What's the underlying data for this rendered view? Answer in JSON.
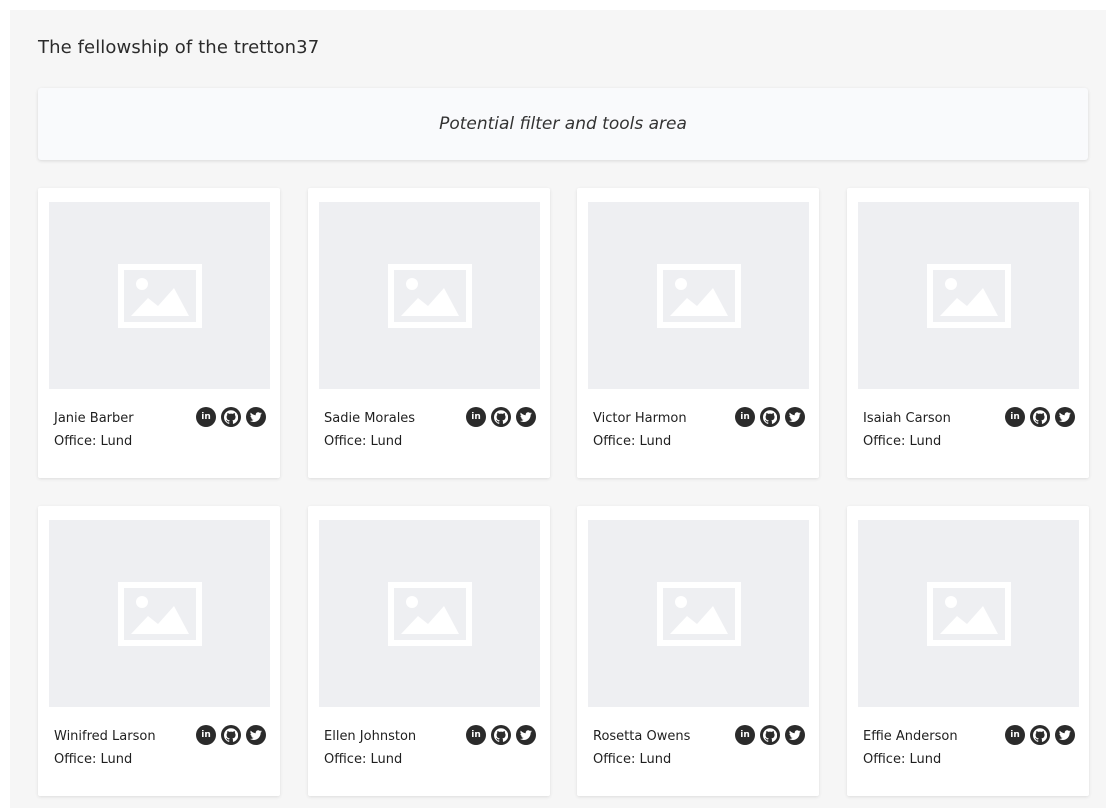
{
  "header": {
    "title": "The fellowship of the tretton37"
  },
  "filter": {
    "text": "Potential filter and tools area"
  },
  "social": {
    "linkedin_glyph": "in"
  },
  "icons": {
    "photo_placeholder": "image-placeholder-icon",
    "linkedin": "linkedin-icon",
    "github": "github-icon",
    "twitter": "twitter-icon"
  },
  "colors": {
    "background": "#f6f6f6",
    "card": "#ffffff",
    "placeholder": "#eeeff2",
    "icon": "#2b2b2b"
  },
  "employees": [
    {
      "name": "Janie Barber",
      "office": "Office: Lund"
    },
    {
      "name": "Sadie Morales",
      "office": "Office: Lund"
    },
    {
      "name": "Victor Harmon",
      "office": "Office: Lund"
    },
    {
      "name": "Isaiah Carson",
      "office": "Office: Lund"
    },
    {
      "name": "Winifred Larson",
      "office": "Office: Lund"
    },
    {
      "name": "Ellen Johnston",
      "office": "Office: Lund"
    },
    {
      "name": "Rosetta Owens",
      "office": "Office: Lund"
    },
    {
      "name": "Effie Anderson",
      "office": "Office: Lund"
    }
  ]
}
